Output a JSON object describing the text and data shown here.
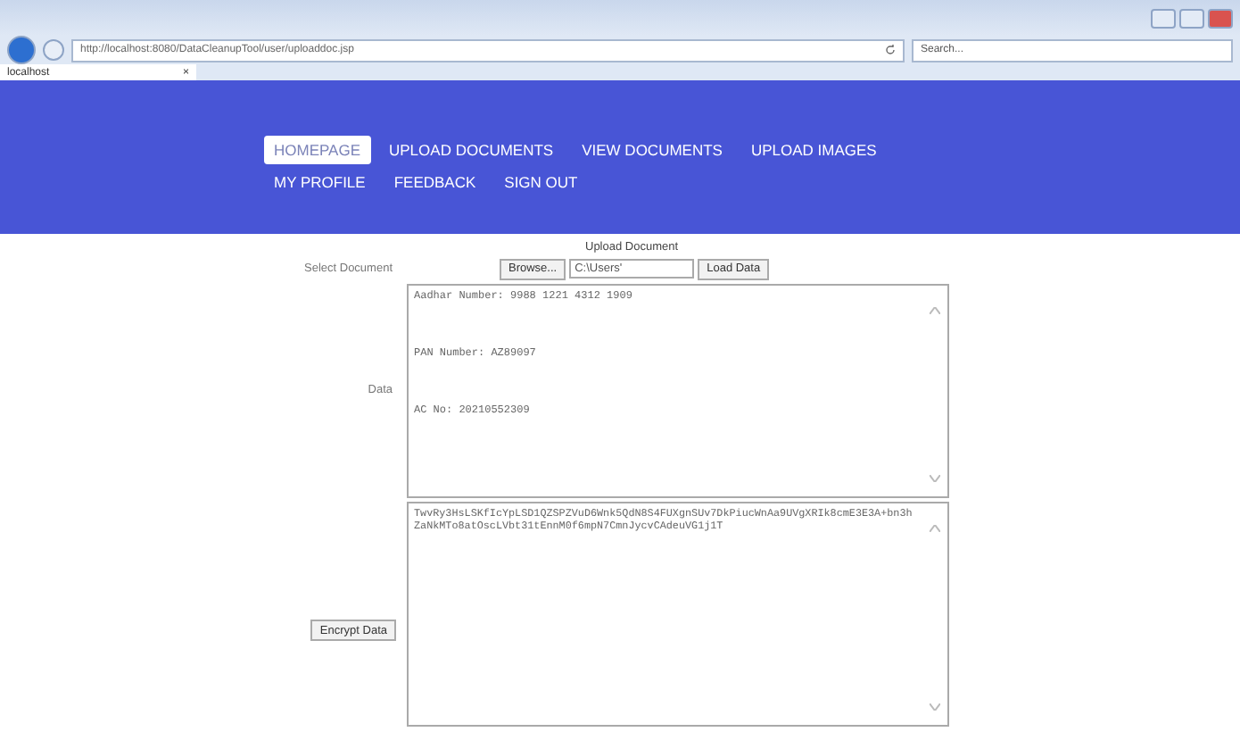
{
  "browser": {
    "url": "http://localhost:8080/DataCleanupTool/user/uploaddoc.jsp",
    "search_placeholder": "Search...",
    "tab": {
      "label": "localhost",
      "close": "×"
    }
  },
  "nav": [
    {
      "label": "HOMEPAGE",
      "selected": true
    },
    {
      "label": "UPLOAD DOCUMENTS",
      "selected": false
    },
    {
      "label": "VIEW DOCUMENTS",
      "selected": false
    },
    {
      "label": "UPLOAD IMAGES",
      "selected": false
    },
    {
      "label": "MY PROFILE",
      "selected": false
    },
    {
      "label": "FEEDBACK",
      "selected": false
    },
    {
      "label": "SIGN OUT",
      "selected": false
    }
  ],
  "form": {
    "title": "Upload Document",
    "select_label": "Select Document",
    "browse_button": "Browse...",
    "path_value": "C:\\Users'",
    "load_button": "Load Data",
    "data_label": "Data",
    "data_lines": [
      "Aadhar Number: 9988 1221 4312 1909",
      "PAN Number: AZ89097",
      "AC No: 20210552309"
    ],
    "encrypt_button": "Encrypt Data",
    "encrypted": "TwvRy3HsLSKfIcYpLSD1QZSPZVuD6Wnk5QdN8S4FUXgnSUv7DkPiucWnAa9UVgXRIk8cmE3E3A+bn3hZaNkMTo8atOscLVbt31tEnnM0f6mpN7CmnJycvCAdeuVG1j1T"
  }
}
